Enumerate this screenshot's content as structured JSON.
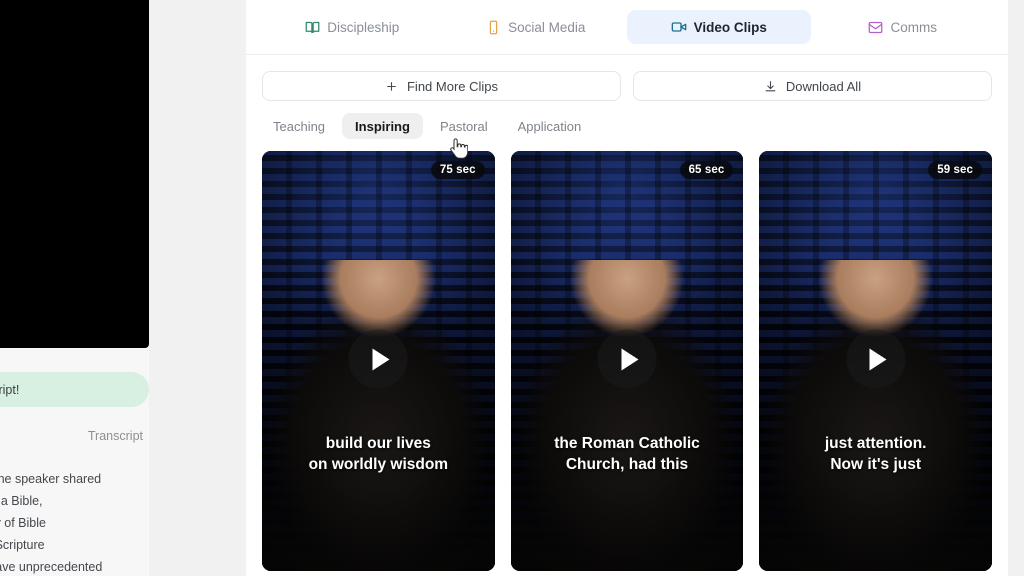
{
  "sidebar": {
    "video_player": "video-preview",
    "chat_message": "e transcript!",
    "transcript_label": "Transcript",
    "transcript_lines": [
      "ney. The speaker shared",
      "h only a Bible,",
      "history of Bible",
      "nake Scripture",
      "e to have unprecedented"
    ]
  },
  "tabs": [
    {
      "label": "Discipleship",
      "icon": "book-icon",
      "color": "#2f8a6a",
      "active": false
    },
    {
      "label": "Social Media",
      "icon": "phone-icon",
      "color": "#e3a44a",
      "active": false
    },
    {
      "label": "Video Clips",
      "icon": "video-camera-icon",
      "color": "#1f6f8f",
      "active": true
    },
    {
      "label": "Comms",
      "icon": "envelope-icon",
      "color": "#b660c9",
      "active": false
    }
  ],
  "actions": [
    {
      "label": "Find More Clips",
      "icon": "plus-icon"
    },
    {
      "label": "Download All",
      "icon": "download-icon"
    }
  ],
  "filters": [
    {
      "label": "Teaching",
      "active": false
    },
    {
      "label": "Inspiring",
      "active": true
    },
    {
      "label": "Pastoral",
      "active": false
    },
    {
      "label": "Application",
      "active": false
    }
  ],
  "clips": [
    {
      "duration": "75 sec",
      "caption_line1": "build our lives",
      "caption_line2": "on worldly wisdom"
    },
    {
      "duration": "65 sec",
      "caption_line1": "the Roman Catholic",
      "caption_line2": "Church, had this"
    },
    {
      "duration": "59 sec",
      "caption_line1": "just attention.",
      "caption_line2": "Now it's just"
    }
  ],
  "colors": {
    "active_tab_bg": "#eaf2fd",
    "panel_bg": "#ffffff",
    "page_bg": "#f1f1f1",
    "chat_bubble": "#d7f0e2"
  }
}
